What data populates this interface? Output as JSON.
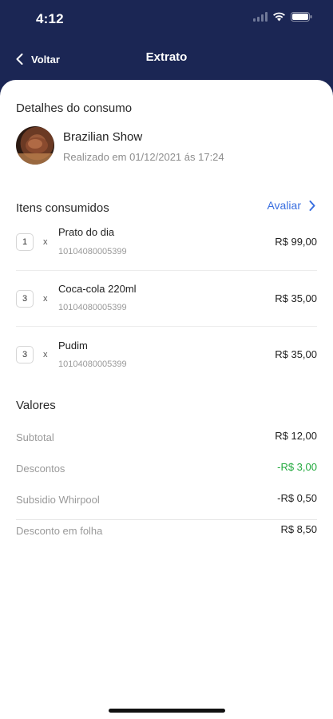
{
  "status_bar": {
    "time": "4:12",
    "icons": [
      "signal-icon",
      "wifi-icon",
      "battery-icon"
    ]
  },
  "nav": {
    "back_label": "Voltar",
    "title": "Extrato",
    "back_icon": "chevron-left-icon"
  },
  "consumption": {
    "section_title": "Detalhes do consumo",
    "merchant_name": "Brazilian Show",
    "date_text": "Realizado em 01/12/2021 ás 17:24"
  },
  "items_section": {
    "title": "Itens consumidos",
    "rate_label": "Avaliar",
    "rate_icon": "chevron-right-icon",
    "items": [
      {
        "qty": "1",
        "times": "x",
        "name": "Prato do dia",
        "code": "10104080005399",
        "price": "R$ 99,00"
      },
      {
        "qty": "3",
        "times": "x",
        "name": "Coca-cola 220ml",
        "code": "10104080005399",
        "price": "R$ 35,00"
      },
      {
        "qty": "3",
        "times": "x",
        "name": "Pudim",
        "code": "10104080005399",
        "price": "R$ 35,00"
      }
    ]
  },
  "values": {
    "title": "Valores",
    "rows": [
      {
        "label": "Subtotal",
        "amount": "R$ 12,00"
      },
      {
        "label": "Descontos",
        "amount": "-R$ 3,00"
      },
      {
        "label": "Subsidio Whirpool",
        "amount": "-R$ 0,50"
      },
      {
        "label": "Desconto em folha",
        "amount": "R$ 8,50"
      }
    ]
  },
  "colors": {
    "header_bg": "#1b2654",
    "link_blue": "#3a6fe0",
    "discount_green": "#20a83c"
  }
}
